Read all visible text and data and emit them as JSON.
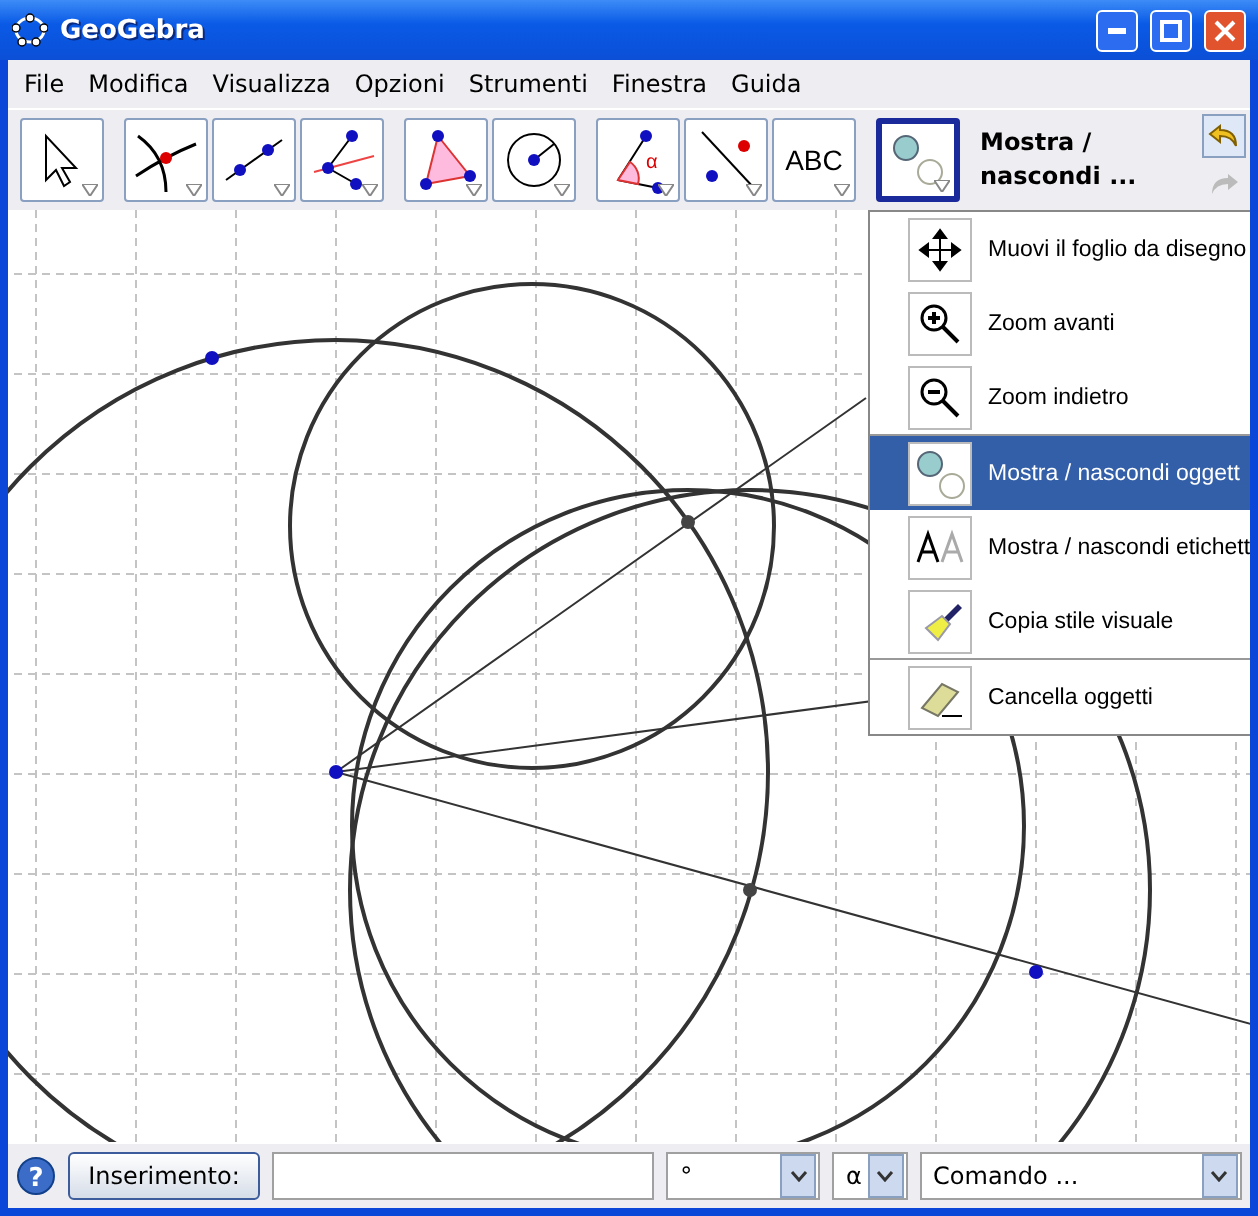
{
  "window": {
    "title": "GeoGebra"
  },
  "menu": [
    "File",
    "Modifica",
    "Visualizza",
    "Opzioni",
    "Strumenti",
    "Finestra",
    "Guida"
  ],
  "tool_groups": [
    [
      {
        "kind": "pointer",
        "selected": false
      }
    ],
    [
      {
        "kind": "intersect",
        "selected": false
      },
      {
        "kind": "segment",
        "selected": false
      },
      {
        "kind": "perpendicular",
        "selected": false
      }
    ],
    [
      {
        "kind": "polygon",
        "selected": false
      },
      {
        "kind": "circle",
        "selected": false
      }
    ],
    [
      {
        "kind": "angle",
        "label": "α",
        "selected": false
      },
      {
        "kind": "reflect",
        "selected": false
      },
      {
        "kind": "text",
        "label": "ABC",
        "selected": false
      }
    ],
    [
      {
        "kind": "showhide",
        "selected": true
      }
    ]
  ],
  "tool_label": "Mostra / nascondi ...",
  "popup": [
    {
      "kind": "move",
      "label": "Muovi il foglio da disegno",
      "selected": false,
      "divider": false
    },
    {
      "kind": "zoomin",
      "label": "Zoom avanti",
      "selected": false,
      "divider": false
    },
    {
      "kind": "zoomout",
      "label": "Zoom indietro",
      "selected": false,
      "divider": false
    },
    {
      "kind": "showhide",
      "label": "Mostra / nascondi oggett",
      "selected": true,
      "divider": true
    },
    {
      "kind": "labels",
      "label": "Mostra / nascondi etichett",
      "selected": false,
      "divider": false
    },
    {
      "kind": "brush",
      "label": "Copia stile visuale",
      "selected": false,
      "divider": false
    },
    {
      "kind": "eraser",
      "label": "Cancella oggetti",
      "selected": false,
      "divider": true
    }
  ],
  "input_bar": {
    "help": "?",
    "button": "Inserimento:",
    "symbol": "°",
    "greek": "α",
    "command": "Comando ..."
  }
}
